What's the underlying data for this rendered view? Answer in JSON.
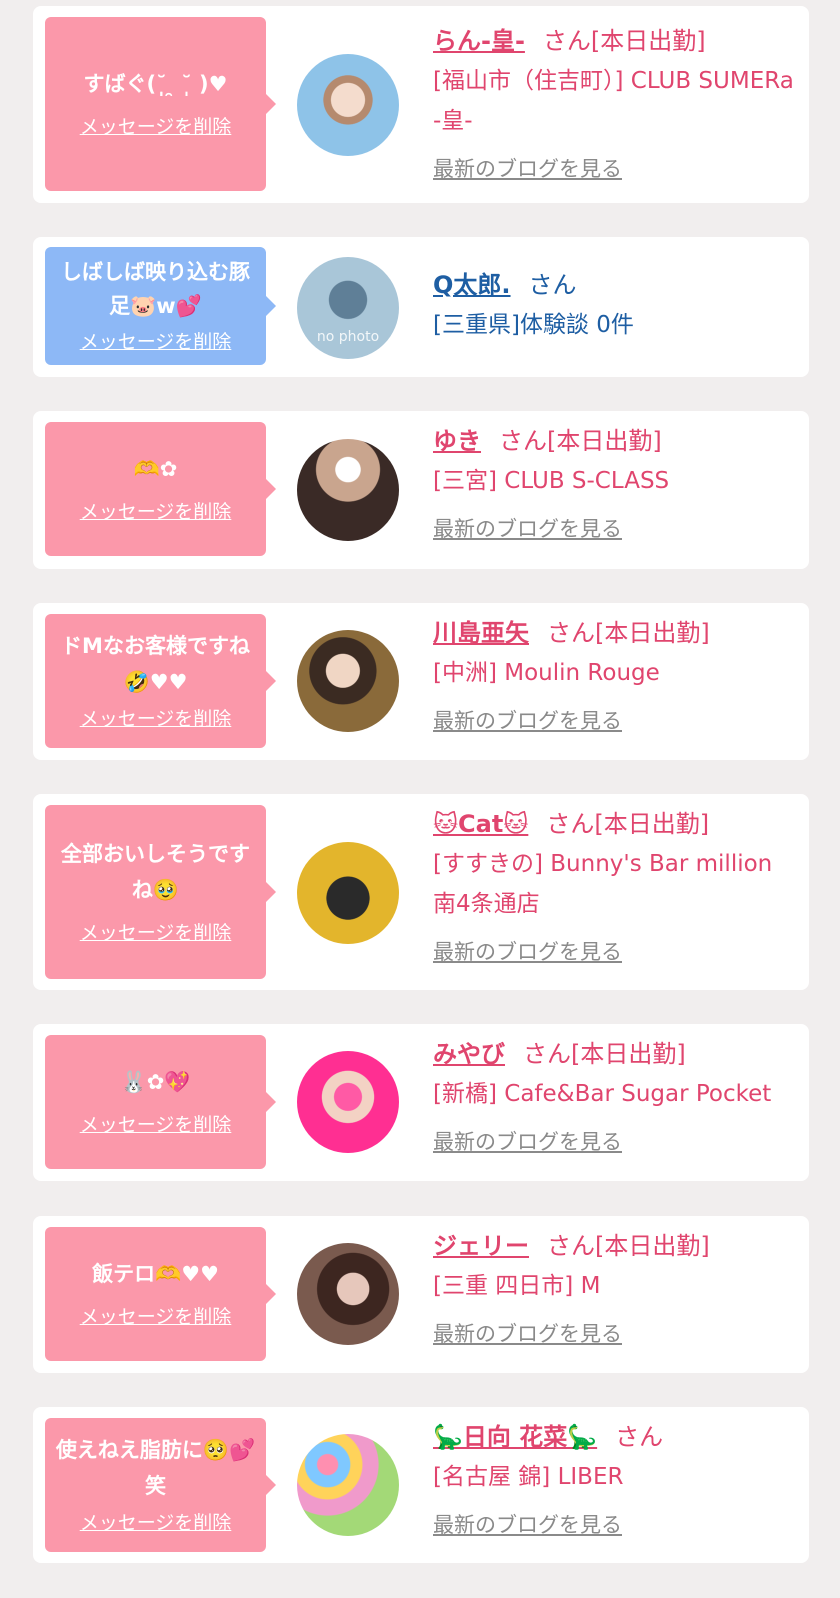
{
  "colors": {
    "background": "#f1eeee",
    "card": "#ffffff",
    "bubble_pink": "#fb98aa",
    "bubble_blue": "#8db8f6",
    "cast_text": "#e0456e",
    "user_text": "#1e5ea3",
    "link_gray": "#8a8a8a"
  },
  "messages": [
    {
      "bubble_text": "すばぐ(˘̩̩̩ ̯ ˘̩̩̩ )♥",
      "delete_label": "メッセージを削除",
      "name": "らん-皇-",
      "suffix": "さん[本日出勤]",
      "shop": "[福山市（住吉町）] CLUB SUMERa -皇-",
      "blog_label": "最新のブログを見る"
    },
    {
      "bubble_text": "しばしば映り込む豚足🐷w💕",
      "delete_label": "メッセージを削除",
      "name": "Q太郎.",
      "suffix": "さん",
      "shop": "[三重県]体験談 0件",
      "avatar_text": "no photo"
    },
    {
      "bubble_text": "🫶✿",
      "delete_label": "メッセージを削除",
      "name": "ゆき",
      "suffix": "さん[本日出勤]",
      "shop": "[三宮] CLUB S-CLASS",
      "blog_label": "最新のブログを見る"
    },
    {
      "bubble_text": "ドMなお客様ですね🤣♥♥",
      "delete_label": "メッセージを削除",
      "name": "川島亜矢",
      "suffix": "さん[本日出勤]",
      "shop": "[中洲] Moulin Rouge",
      "blog_label": "最新のブログを見る"
    },
    {
      "bubble_text": "全部おいしそうですね🥹",
      "delete_label": "メッセージを削除",
      "name": "🐱Cat🐱",
      "suffix": "さん[本日出勤]",
      "shop": "[すすきの] Bunny's Bar million 南4条通店",
      "blog_label": "最新のブログを見る"
    },
    {
      "bubble_text": "🐰✿💖",
      "delete_label": "メッセージを削除",
      "name": "みやび",
      "suffix": "さん[本日出勤]",
      "shop": "[新橋] Cafe&Bar Sugar Pocket",
      "blog_label": "最新のブログを見る"
    },
    {
      "bubble_text": "飯テロ🫶♥♥",
      "delete_label": "メッセージを削除",
      "name": "ジェリー",
      "suffix": "さん[本日出勤]",
      "shop": "[三重 四日市] M",
      "blog_label": "最新のブログを見る"
    },
    {
      "bubble_text": "使えねえ脂肪に🥺💕笑",
      "delete_label": "メッセージを削除",
      "name": "🦕日向 花菜🦕",
      "suffix": "さん",
      "shop": "[名古屋 錦] LIBER",
      "blog_label": "最新のブログを見る"
    }
  ]
}
